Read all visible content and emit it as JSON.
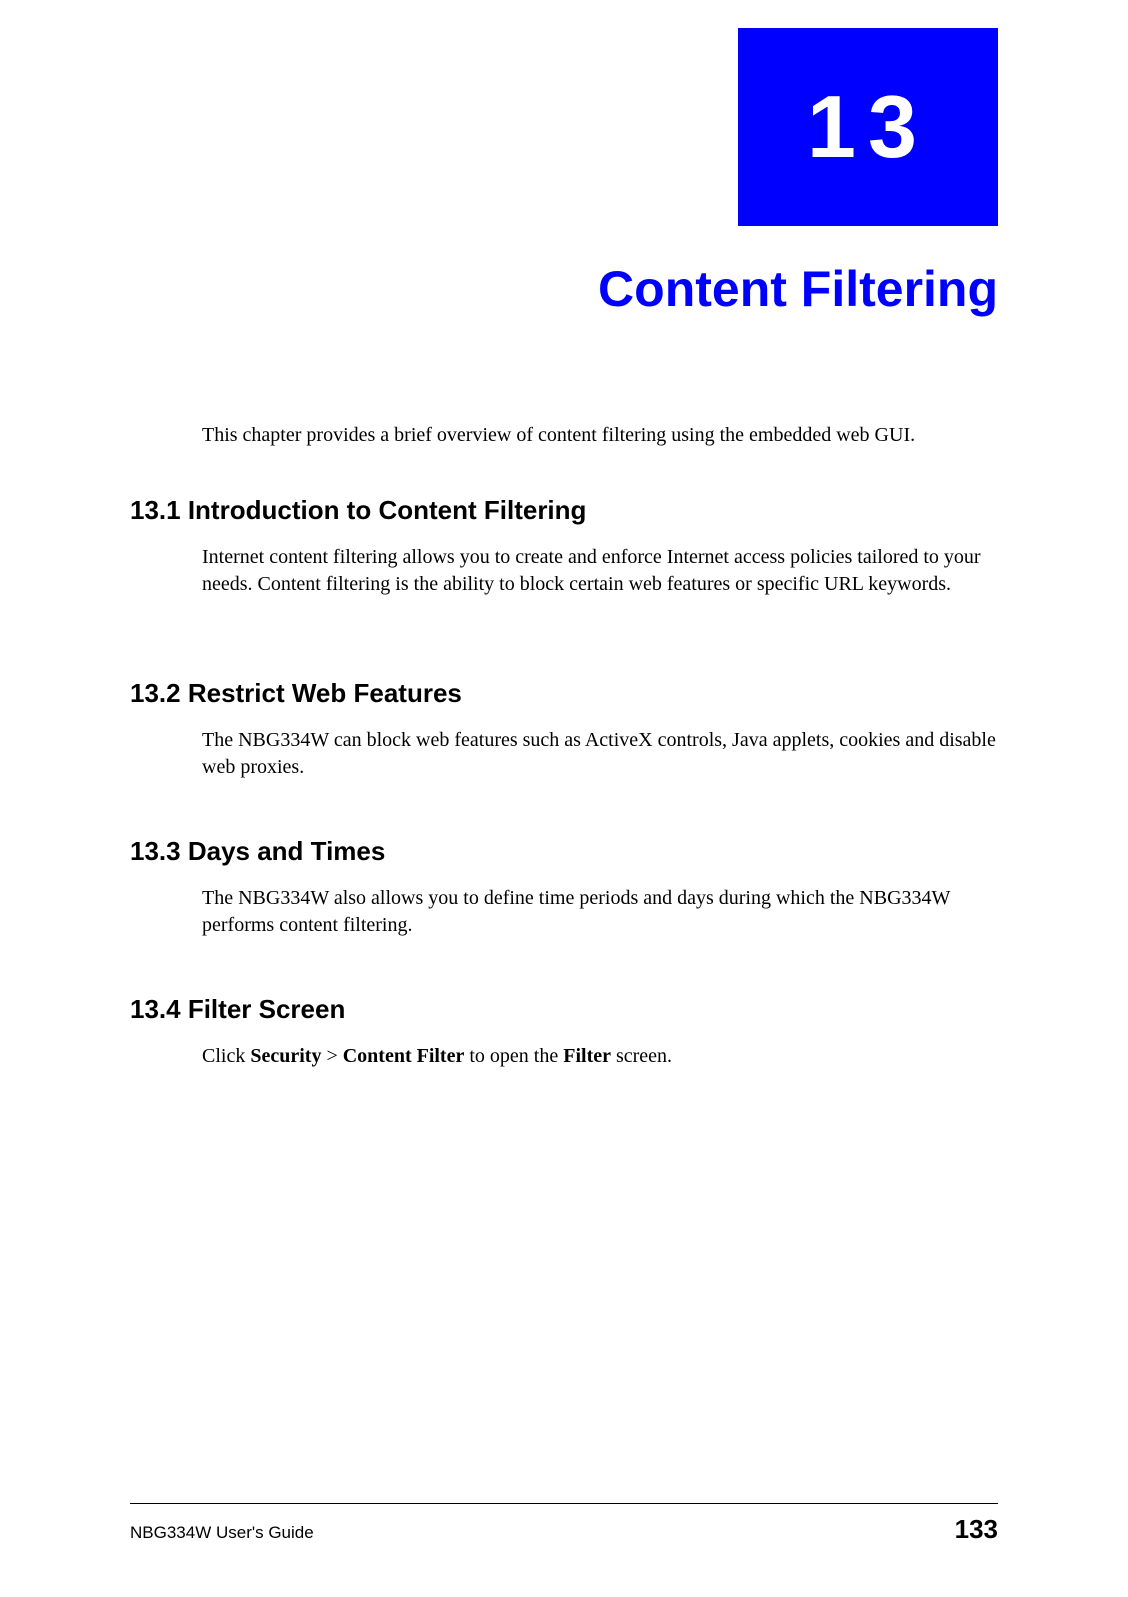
{
  "chapter": {
    "number": "13",
    "title": "Content Filtering",
    "intro": "This chapter provides a brief overview of content filtering using the embedded web GUI."
  },
  "sections": {
    "s1": {
      "heading": "13.1  Introduction to Content Filtering",
      "body": "Internet content filtering allows you to create and enforce Internet access policies tailored to your needs. Content filtering is the ability to block certain web features or specific URL keywords."
    },
    "s2": {
      "heading": "13.2  Restrict Web Features",
      "body": "The NBG334W can block web features such as ActiveX controls, Java applets, cookies and disable web proxies."
    },
    "s3": {
      "heading": "13.3  Days and Times",
      "body": "The NBG334W also allows you to define time periods and days during which the NBG334W performs content filtering."
    },
    "s4": {
      "heading": "13.4  Filter Screen",
      "body_prefix": "Click ",
      "nav1": "Security",
      "sep1": " > ",
      "nav2": "Content Filter",
      "mid": " to open the ",
      "nav3": "Filter",
      "suffix": " screen."
    }
  },
  "footer": {
    "guide": "NBG334W User's Guide",
    "page": "133"
  }
}
